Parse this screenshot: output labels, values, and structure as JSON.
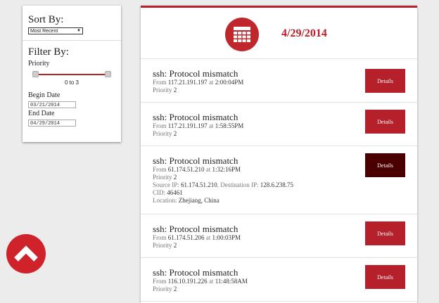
{
  "sidebar": {
    "sort_heading": "Sort By:",
    "sort_selected": "Most Recent",
    "filter_heading": "Filter By:",
    "priority_label": "Priority",
    "priority_range": "0 to 3",
    "begin_label": "Begin Date",
    "begin_value": "03/21/2014",
    "end_label": "End Date",
    "end_value": "04/29/2014"
  },
  "header": {
    "date": "4/29/2014",
    "icon": "calendar-icon"
  },
  "entries": [
    {
      "title": "ssh: Protocol mismatch",
      "from_label": "From",
      "ip": "117.21.191.197",
      "at_label": "at",
      "time": "2:00:04PM",
      "priority_label": "Priority",
      "priority": "2",
      "button": "Details"
    },
    {
      "title": "ssh: Protocol mismatch",
      "from_label": "From",
      "ip": "117.21.191.197",
      "at_label": "at",
      "time": "1:58:55PM",
      "priority_label": "Priority",
      "priority": "2",
      "button": "Details"
    },
    {
      "title": "ssh: Protocol mismatch",
      "from_label": "From",
      "ip": "61.174.51.210",
      "at_label": "at",
      "time": "1:32:16PM",
      "priority_label": "Priority",
      "priority": "2",
      "button": "Details",
      "source_label": "Source IP:",
      "source_ip": "61.174.51.210",
      "dest_label": "Destination IP:",
      "dest_ip": "128.6.238.75",
      "cid_label": "CID:",
      "cid": "46461",
      "location_label": "Location:",
      "location": "Zhejiang, China"
    },
    {
      "title": "ssh: Protocol mismatch",
      "from_label": "From",
      "ip": "61.174.51.206",
      "at_label": "at",
      "time": "1:00:03PM",
      "priority_label": "Priority",
      "priority": "2",
      "button": "Details"
    },
    {
      "title": "ssh: Protocol mismatch",
      "from_label": "From",
      "ip": "116.10.191.226",
      "at_label": "at",
      "time": "11:48:58AM",
      "priority_label": "Priority",
      "priority": "2",
      "button": "Details"
    }
  ],
  "colors": {
    "accent": "#b5202a",
    "active_button": "#4a0000"
  },
  "scroll_top_icon": "chevron-up-icon"
}
